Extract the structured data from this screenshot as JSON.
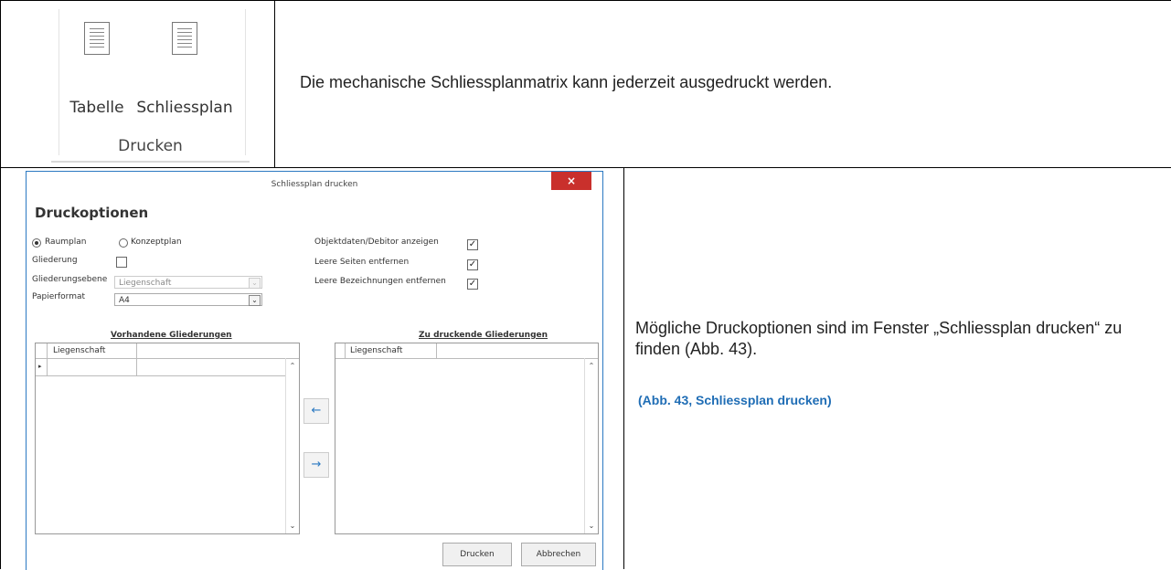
{
  "ribbon": {
    "btn_table": "Tabelle",
    "btn_plan": "Schliessplan",
    "group": "Drucken"
  },
  "text1": "Die mechanische Schliessplanmatrix kann jederzeit ausgedruckt werden.",
  "text2": "Mögliche Druckoptionen sind im Fenster „Schliessplan drucken“ zu finden (Abb. 43).",
  "caption": "(Abb. 43, Schliessplan drucken)",
  "dialog": {
    "title": "Schliessplan drucken",
    "close": "×",
    "heading": "Druckoptionen",
    "radio_raumplan": "Raumplan",
    "radio_konzeptplan": "Konzeptplan",
    "selected_radio": "Raumplan",
    "gliederung": "Gliederung",
    "gliederungsebene": "Gliederungsebene",
    "gliederungsebene_value": "Liegenschaft",
    "papierformat": "Papierformat",
    "papierformat_value": "A4",
    "opt_objektdaten": "Objektdaten/Debitor anzeigen",
    "opt_leere_seiten": "Leere Seiten entfernen",
    "opt_leere_bez": "Leere Bezeichnungen entfernen",
    "left_title": "Vorhandene Gliederungen",
    "right_title": "Zu druckende Gliederungen",
    "col_liegenschaft": "Liegenschaft",
    "btn_left": "←",
    "btn_right": "→",
    "btn_print": "Drucken",
    "btn_cancel": "Abbrechen",
    "check_mark": "✓",
    "dropdown_arrow": "⌄"
  }
}
